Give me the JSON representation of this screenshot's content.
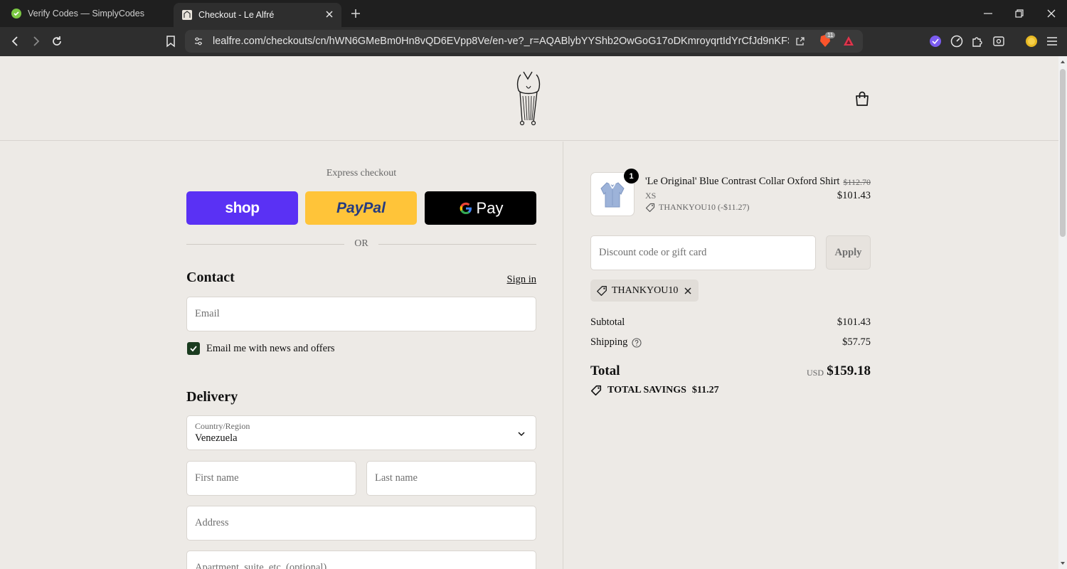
{
  "browser": {
    "tabs": [
      {
        "title": "Verify Codes — SimplyCodes",
        "active": false
      },
      {
        "title": "Checkout - Le Alfré",
        "active": true
      }
    ],
    "url": "lealfre.com/checkouts/cn/hWN6GMeBm0Hn8vQD6EVpp8Ve/en-ve?_r=AQABlybYYShb2OwGoG17oDKmroyqrtIdYrCfJd9nKFS8s-s&a...",
    "brave_badge": "11",
    "colors": {
      "frame": "#1f1f1f",
      "toolbar": "#2e2e2e",
      "urlbar": "#3a3a3a"
    }
  },
  "express": {
    "label": "Express checkout",
    "shop_label": "shop",
    "paypal_label": "PayPal",
    "gpay_label": "Pay",
    "or_label": "OR",
    "colors": {
      "shop": "#5a31f4",
      "paypal": "#ffc439",
      "gpay": "#000000"
    }
  },
  "contact": {
    "title": "Contact",
    "sign_in": "Sign in",
    "email_placeholder": "Email",
    "newsletter_label": "Email me with news and offers",
    "newsletter_checked": true
  },
  "delivery": {
    "title": "Delivery",
    "country_label": "Country/Region",
    "country_value": "Venezuela",
    "first_name_placeholder": "First name",
    "last_name_placeholder": "Last name",
    "address_placeholder": "Address",
    "apartment_placeholder": "Apartment, suite, etc. (optional)"
  },
  "summary": {
    "item": {
      "quantity": "1",
      "name": "'Le Original' Blue Contrast Collar Oxford Shirt",
      "variant": "XS",
      "discount_line": "THANKYOU10 (-$11.27)",
      "original_price": "$112.70",
      "price": "$101.43"
    },
    "discount_placeholder": "Discount code or gift card",
    "apply_label": "Apply",
    "applied_code": "THANKYOU10",
    "subtotal_label": "Subtotal",
    "subtotal_value": "$101.43",
    "shipping_label": "Shipping",
    "shipping_value": "$57.75",
    "total_label": "Total",
    "currency": "USD",
    "total_value": "$159.18",
    "savings_label": "TOTAL SAVINGS",
    "savings_value": "$11.27"
  },
  "page_colors": {
    "background": "#edeae6",
    "accent_checkbox": "#1a3b1f"
  }
}
